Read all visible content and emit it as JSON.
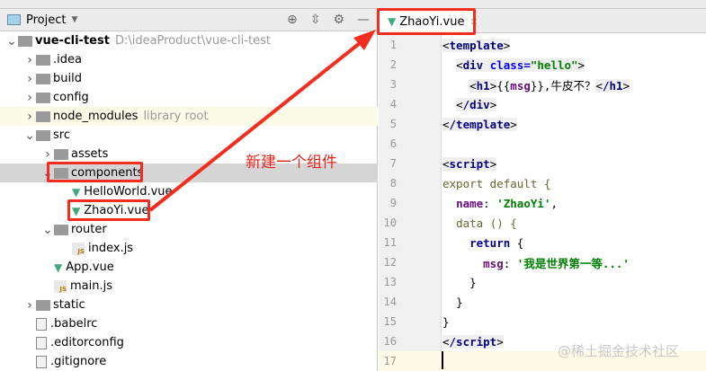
{
  "project_panel": {
    "title": "Project",
    "tools": [
      "locate-icon",
      "collapse-icon",
      "gear-icon",
      "minimize-icon"
    ],
    "tree": [
      {
        "label": "vue-cli-test",
        "hint": "D:\\ideaProduct\\vue-cli-test",
        "type": "module",
        "depth": 0,
        "arrow": "v"
      },
      {
        "label": ".idea",
        "type": "folder",
        "depth": 1,
        "arrow": ">"
      },
      {
        "label": "build",
        "type": "folder",
        "depth": 1,
        "arrow": ">"
      },
      {
        "label": "config",
        "type": "folder",
        "depth": 1,
        "arrow": ">"
      },
      {
        "label": "node_modules",
        "hint": "library root",
        "type": "folder",
        "depth": 1,
        "arrow": ">"
      },
      {
        "label": "src",
        "type": "folder",
        "depth": 1,
        "arrow": "v"
      },
      {
        "label": "assets",
        "type": "folder",
        "depth": 2,
        "arrow": ">"
      },
      {
        "label": "components",
        "type": "folder",
        "depth": 2,
        "arrow": "v",
        "selected": true
      },
      {
        "label": "HelloWorld.vue",
        "type": "vue",
        "depth": 3
      },
      {
        "label": "ZhaoYi.vue",
        "type": "vue",
        "depth": 3
      },
      {
        "label": "router",
        "type": "folder",
        "depth": 2,
        "arrow": "v"
      },
      {
        "label": "index.js",
        "type": "js",
        "depth": 3
      },
      {
        "label": "App.vue",
        "type": "vue",
        "depth": 2
      },
      {
        "label": "main.js",
        "type": "js",
        "depth": 2
      },
      {
        "label": "static",
        "type": "folder",
        "depth": 1,
        "arrow": ">"
      },
      {
        "label": ".babelrc",
        "type": "file",
        "depth": 1
      },
      {
        "label": ".editorconfig",
        "type": "file",
        "depth": 1
      },
      {
        "label": ".gitignore",
        "type": "file",
        "depth": 1
      }
    ]
  },
  "editor": {
    "tab": "ZhaoYi.vue",
    "lines": [
      "1",
      "2",
      "3",
      "4",
      "5",
      "6",
      "7",
      "8",
      "9",
      "10",
      "11",
      "12",
      "13",
      "14",
      "15",
      "16",
      "17"
    ],
    "code": {
      "l1": "template",
      "l2a": "div",
      "l2b": "class=",
      "l2c": "\"hello\"",
      "l3a": "h1",
      "l3b": "{{",
      "l3c": "msg",
      "l3d": "}},牛皮不？",
      "l3e": "/h1",
      "l4": "/div",
      "l5": "/template",
      "l7": "script",
      "l8": "export default {",
      "l9a": "name",
      "l9b": "'ZhaoYi'",
      "l10": "data () {",
      "l11": "return",
      "l12a": "msg",
      "l12b": "'我是世界第一等...'",
      "l13": "}",
      "l14": "}",
      "l15": "}",
      "l16": "/script"
    }
  },
  "annotation": {
    "text": "新建一个组件",
    "color": "#f02d1e"
  },
  "watermark": "@稀土掘金技术社区"
}
